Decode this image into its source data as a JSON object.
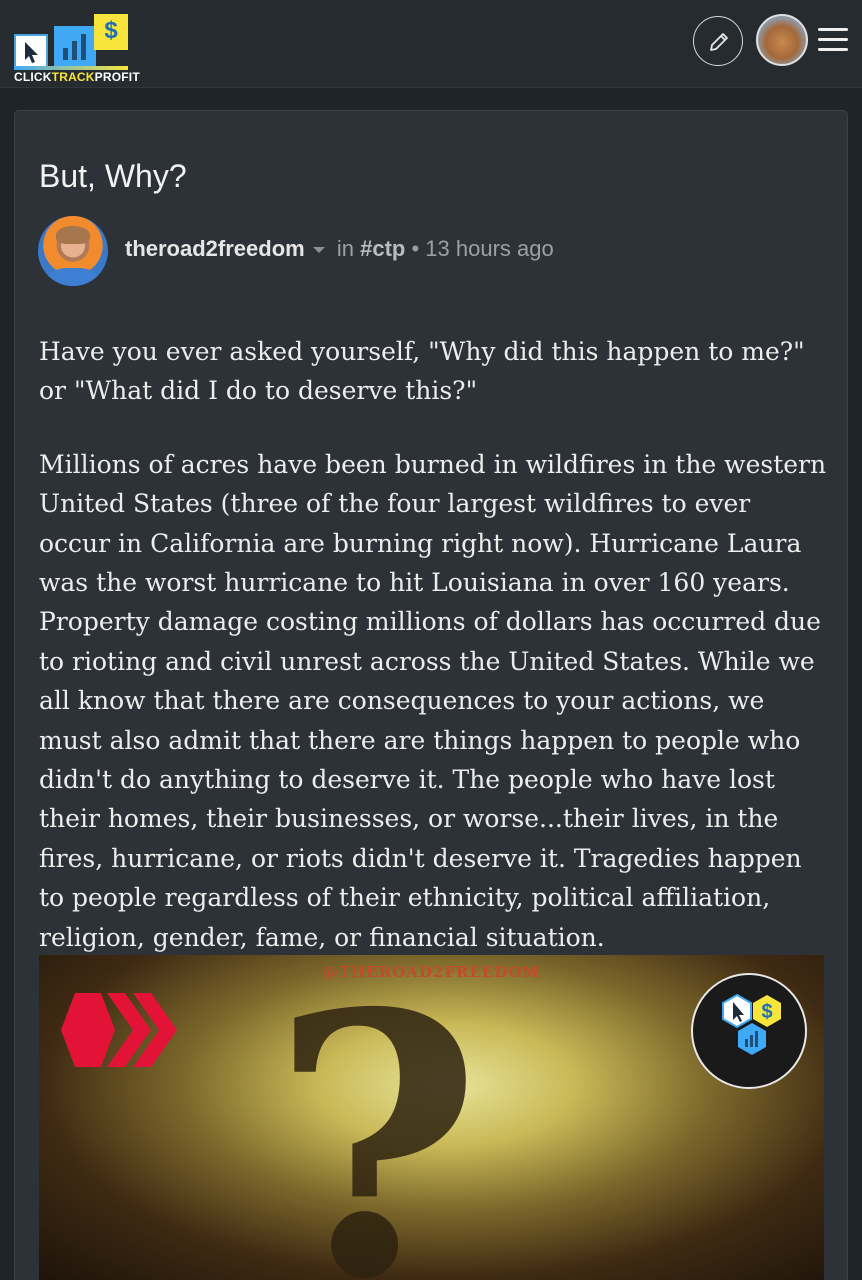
{
  "header": {
    "logo_text_1": "CLICK",
    "logo_text_2": "TRACK",
    "logo_text_3": "PROFIT",
    "logo_dollar": "$",
    "edit_icon": "pencil-icon",
    "menu_icon": "hamburger-menu-icon"
  },
  "post": {
    "title": "But, Why?",
    "author": "theroad2freedom",
    "in_label": "in",
    "community": "#ctp",
    "separator": "•",
    "time": "13 hours ago",
    "paragraphs": [
      "Have you ever asked yourself, \"Why did this happen to me?\" or \"What did I do to deserve this?\"",
      "Millions of acres have been burned in wildfires in the western United States (three of the four largest wildfires to ever occur in California are burning right now). Hurricane Laura was the worst hurricane to hit Louisiana in over 160 years. Property damage costing millions of dollars has occurred due to rioting and civil unrest across the United States. While we all know that there are consequences to your actions, we must also admit that there are things happen to people who didn't do anything to deserve it. The people who have lost their homes, their businesses, or worse...their lives, in the fires, hurricane, or riots didn't deserve it. Tragedies happen to people regardless of their ethnicity, political affiliation, religion, gender, fame, or financial situation."
    ],
    "image": {
      "watermark": "@THEROAD2FREEDOM",
      "glyph": "?",
      "badge_dollar": "$"
    }
  },
  "colors": {
    "background": "#1f2429",
    "card": "#2c3238",
    "hive_red": "#e31337",
    "logo_blue": "#3fa9f5",
    "logo_yellow": "#f7e53b"
  }
}
